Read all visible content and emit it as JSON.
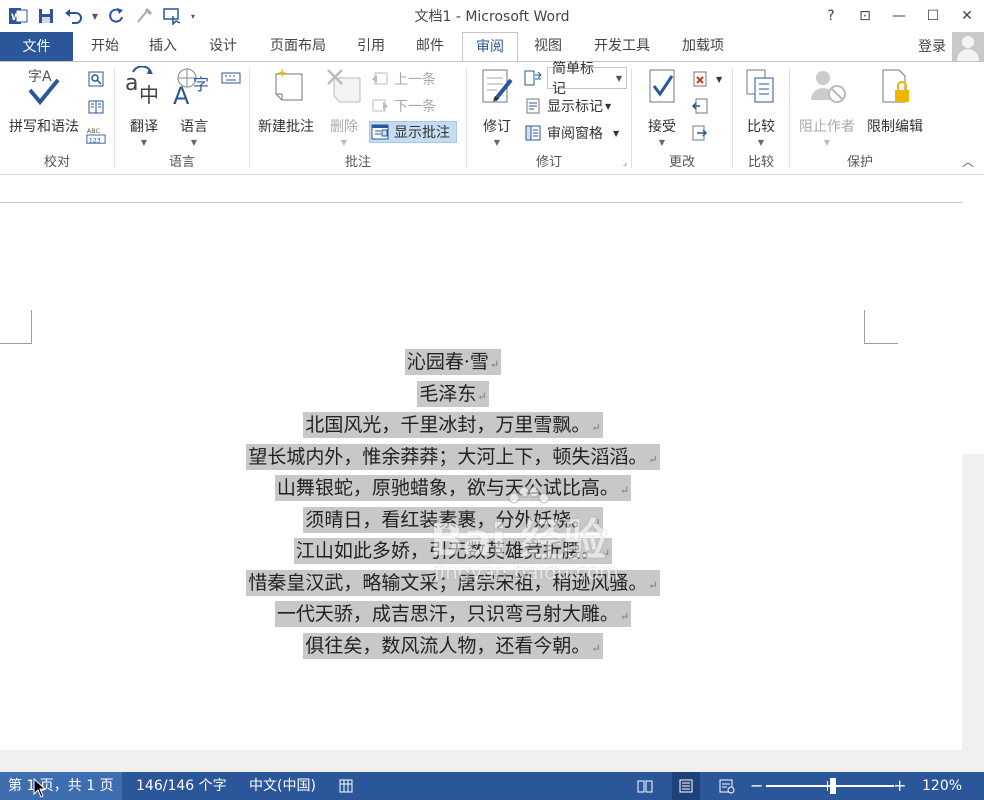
{
  "app": {
    "title": "文档1 - Microsoft Word",
    "colors": {
      "accent": "#2b579a",
      "highlight": "#c8c8c8"
    }
  },
  "window_controls": {
    "help": "?",
    "ribbon_display": "⊡",
    "minimize": "—",
    "restore": "☐",
    "close": "✕"
  },
  "tabs": [
    {
      "label": "文件",
      "type": "file"
    },
    {
      "label": "开始"
    },
    {
      "label": "插入"
    },
    {
      "label": "设计"
    },
    {
      "label": "页面布局"
    },
    {
      "label": "引用"
    },
    {
      "label": "邮件"
    },
    {
      "label": "审阅",
      "active": true
    },
    {
      "label": "视图"
    },
    {
      "label": "开发工具"
    },
    {
      "label": "加载项"
    }
  ],
  "account": {
    "login": "登录"
  },
  "ribbon": {
    "proofing": {
      "label": "校对",
      "spelling": "拼写和语法"
    },
    "language": {
      "label": "语言",
      "translate": "翻译",
      "language": "语言"
    },
    "comments": {
      "label": "批注",
      "new_comment": "新建批注",
      "delete": "删除",
      "previous": "上一条",
      "next": "下一条",
      "show_comments": "显示批注"
    },
    "tracking": {
      "label": "修订",
      "track_changes": "修订",
      "markup_combo": "简单标记",
      "show_markup": "显示标记",
      "reviewing_pane": "审阅窗格"
    },
    "changes": {
      "label": "更改",
      "accept": "接受"
    },
    "compare": {
      "label": "比较",
      "compare": "比较"
    },
    "protect": {
      "label": "保护",
      "block_authors": "阻止作者",
      "restrict_editing": "限制编辑"
    }
  },
  "document": {
    "lines": [
      "沁园春·雪",
      "毛泽东",
      "北国风光，千里冰封，万里雪飘。",
      "望长城内外，惟余莽莽；大河上下，顿失滔滔。",
      "山舞银蛇，原驰蜡象，欲与天公试比高。",
      "须晴日，看红装素裹，分外妖娆。",
      "江山如此多娇，引无数英雄竞折腰。",
      "惜秦皇汉武，略输文采；唐宗宋祖，稍逊风骚。",
      "一代天骄，成吉思汗，只识弯弓射大雕。",
      "俱往矣，数风流人物，还看今朝。"
    ],
    "paragraph_mark": "↵"
  },
  "watermark": {
    "main": "Bai 经验",
    "sub": "jingyan.baidu.com"
  },
  "status": {
    "page": "第 1 页，共 1 页",
    "words": "146/146 个字",
    "language": "中文(中国)",
    "zoom": "120%",
    "zoom_minus": "−",
    "zoom_plus": "+"
  }
}
